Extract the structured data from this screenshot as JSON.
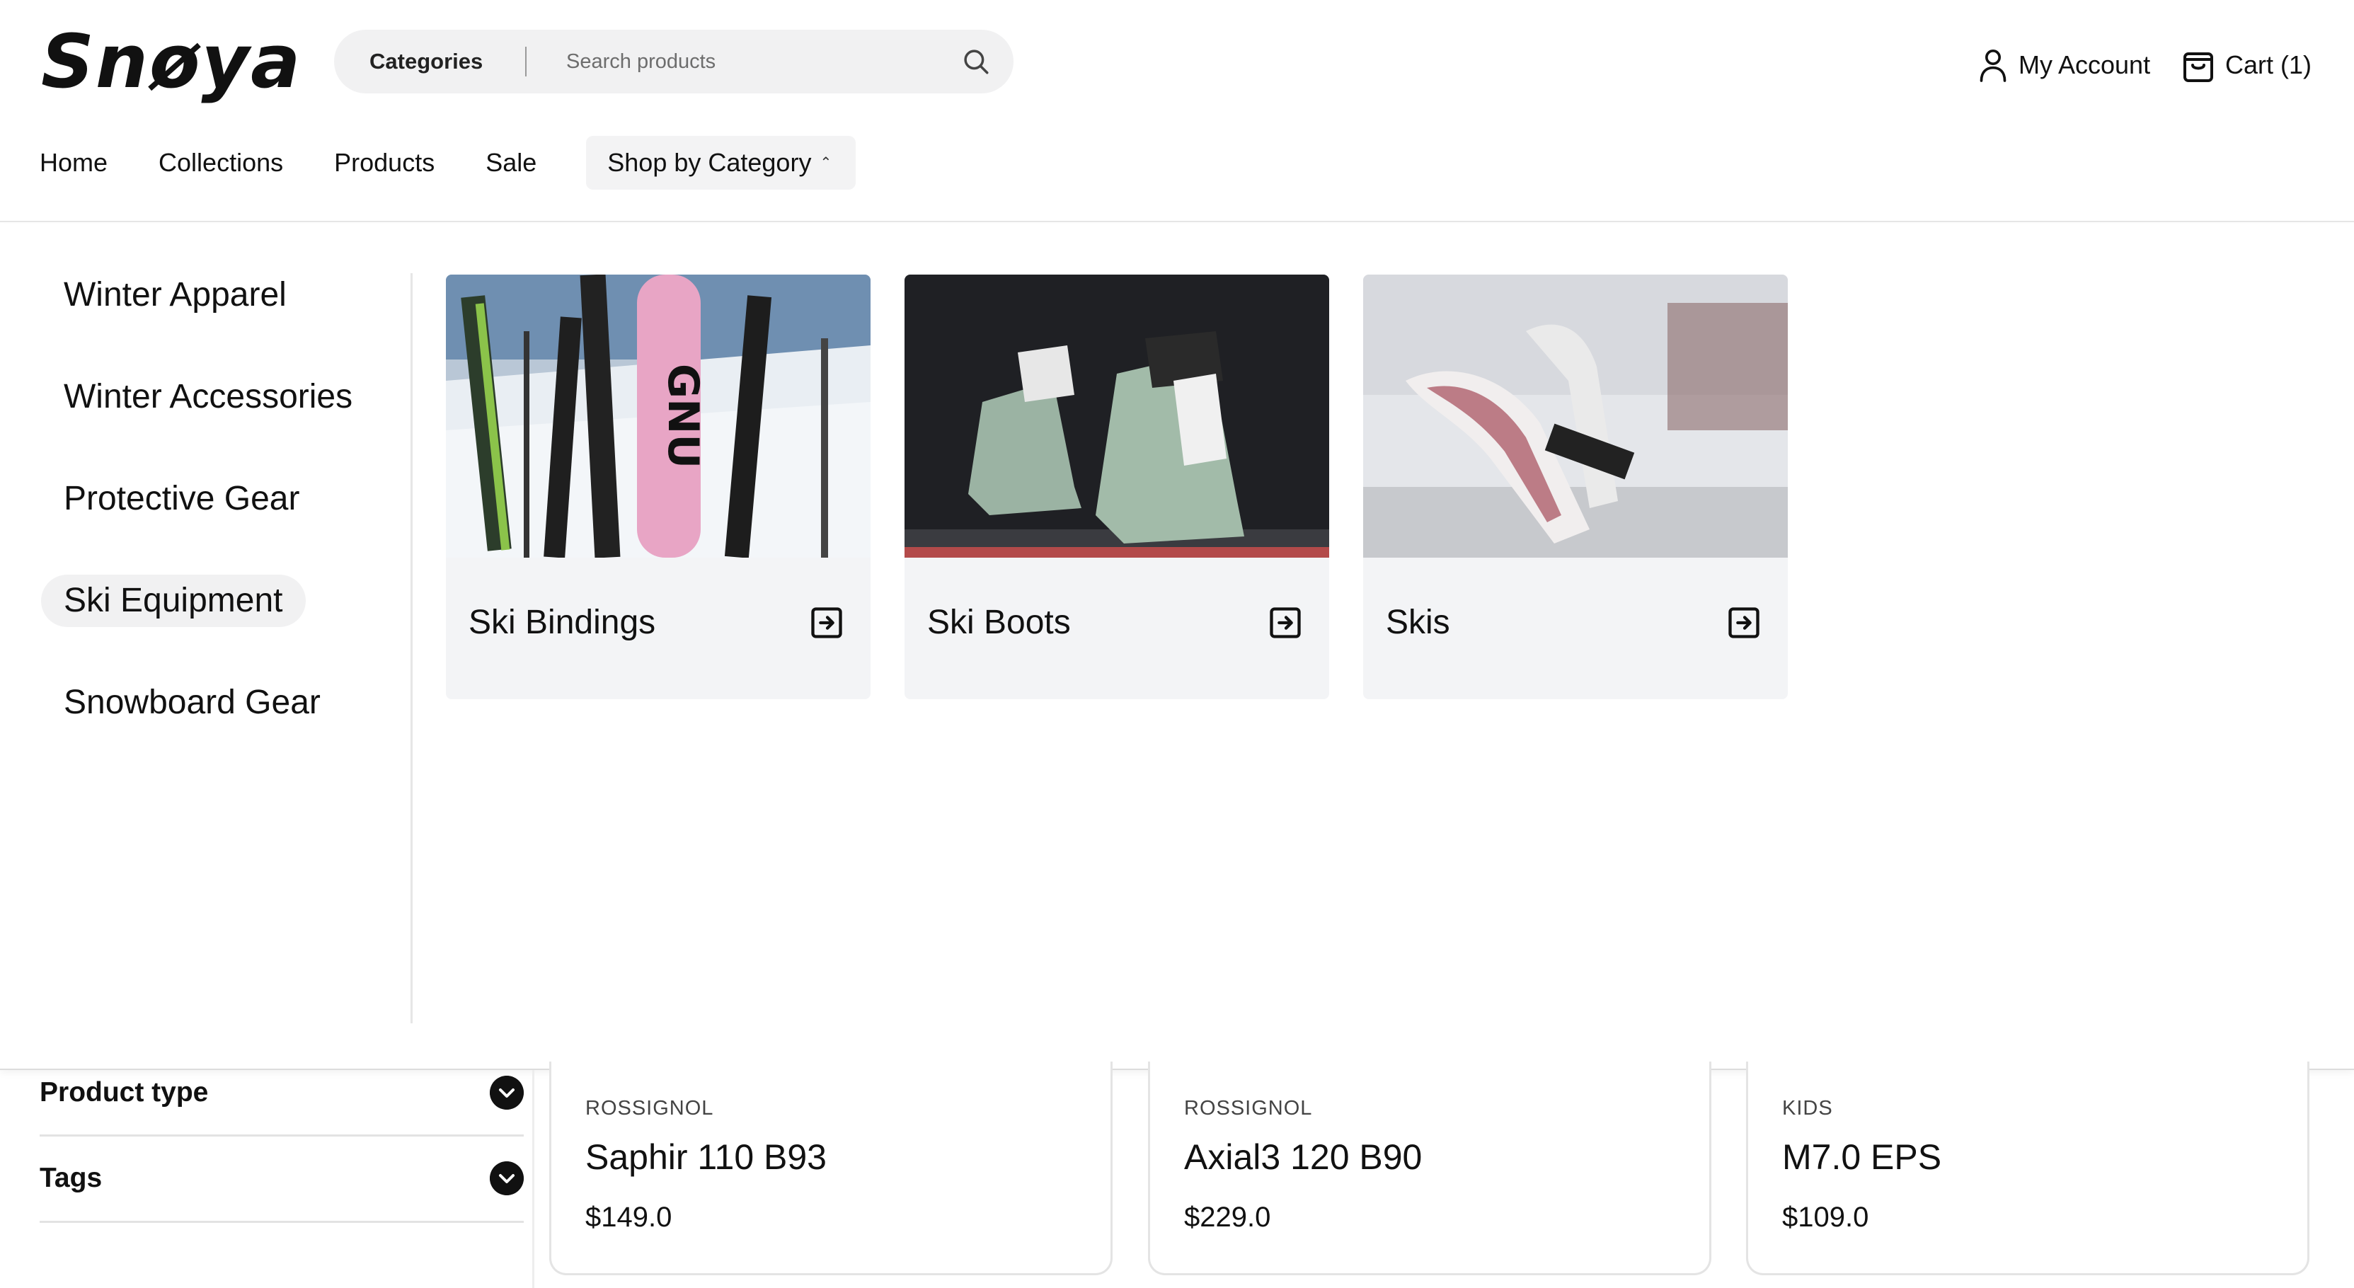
{
  "header": {
    "logo": "Snøya",
    "search": {
      "category_label": "Categories",
      "placeholder": "Search products"
    },
    "account_label": "My Account",
    "cart_label": "Cart (1)"
  },
  "nav": {
    "items": [
      "Home",
      "Collections",
      "Products",
      "Sale"
    ],
    "dropdown_label": "Shop by Category"
  },
  "mega_menu": {
    "categories": [
      "Winter Apparel",
      "Winter Accessories",
      "Protective Gear",
      "Ski Equipment",
      "Snowboard Gear"
    ],
    "active_category": "Ski Equipment",
    "cards": [
      {
        "title": "Ski Bindings",
        "icon": "arrow-right-square-icon"
      },
      {
        "title": "Ski Boots",
        "icon": "arrow-right-square-icon"
      },
      {
        "title": "Skis",
        "icon": "arrow-right-square-icon"
      }
    ]
  },
  "filters": [
    {
      "label": "Product type"
    },
    {
      "label": "Tags"
    }
  ],
  "products": [
    {
      "brand": "ROSSIGNOL",
      "name": "Saphir 110 B93",
      "price": "$149.0"
    },
    {
      "brand": "ROSSIGNOL",
      "name": "Axial3 120 B90",
      "price": "$229.0"
    },
    {
      "brand": "KIDS",
      "name": "M7.0 EPS",
      "price": "$109.0"
    }
  ],
  "colors": {
    "accent": "#111111",
    "surface": "#f3f4f6",
    "border": "#e4e4e4"
  }
}
